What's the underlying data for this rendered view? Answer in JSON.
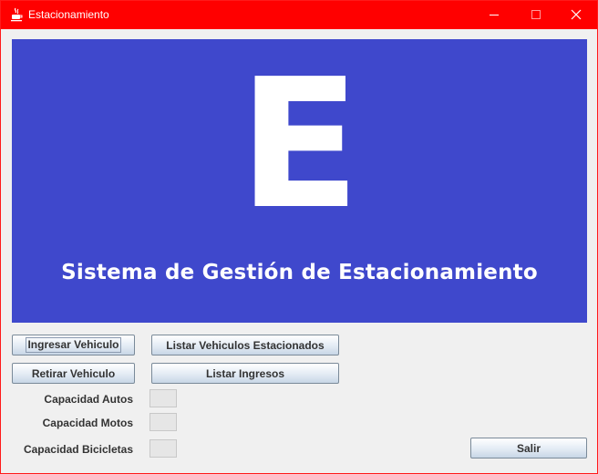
{
  "window": {
    "title": "Estacionamiento",
    "colors": {
      "titlebar": "#ff0000",
      "banner": "#3f48cc",
      "background": "#f0f0f0"
    },
    "icons": {
      "app": "java-cup-icon",
      "minimize": "minimize-icon",
      "maximize": "maximize-icon",
      "close": "close-icon"
    }
  },
  "banner": {
    "letter": "E",
    "title": "Sistema de Gestión de Estacionamiento"
  },
  "actions": {
    "ingresar": "Ingresar Vehiculo",
    "listar_vehiculos": "Listar Vehiculos Estacionados",
    "retirar": "Retirar Vehiculo",
    "listar_ingresos": "Listar Ingresos",
    "salir": "Salir"
  },
  "capacidad": {
    "autos_label": "Capacidad Autos",
    "motos_label": "Capacidad Motos",
    "bicicletas_label": "Capacidad Bicicletas",
    "autos_value": "",
    "motos_value": "",
    "bicicletas_value": ""
  }
}
